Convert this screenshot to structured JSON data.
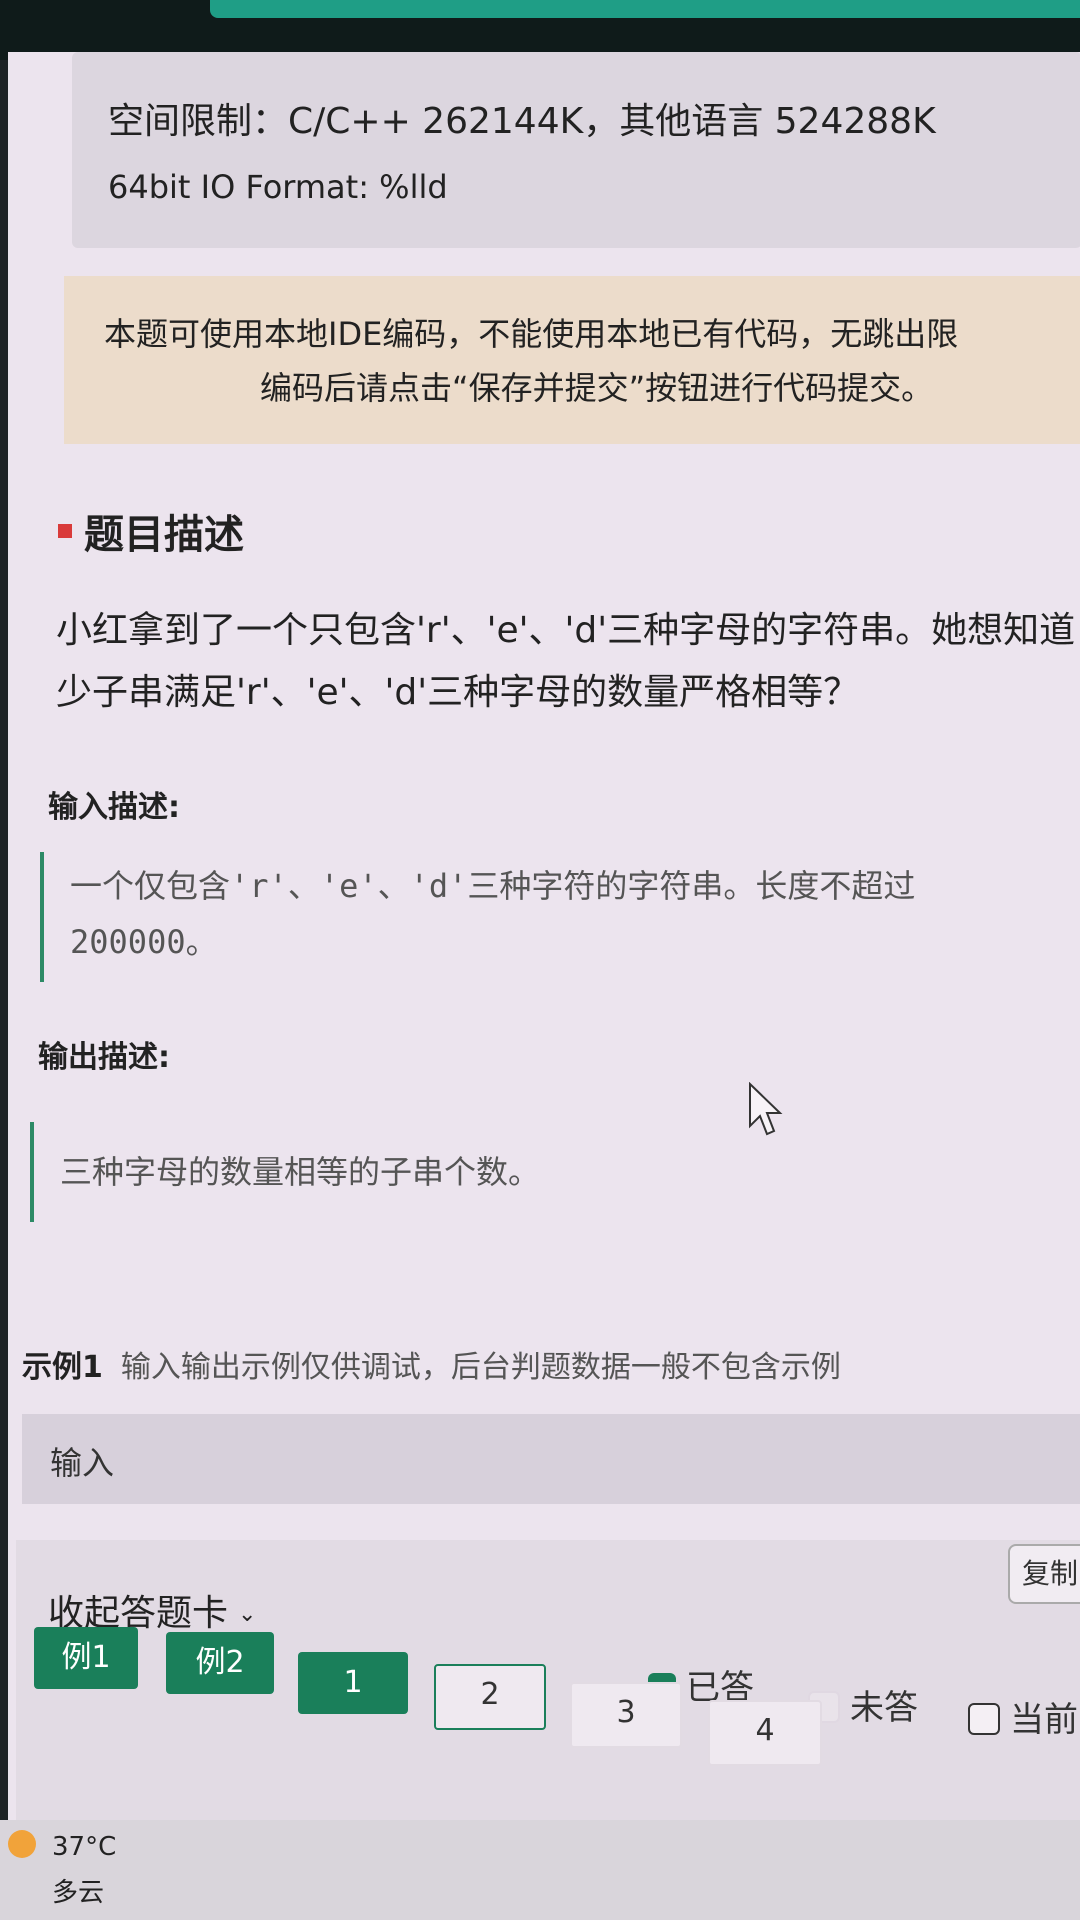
{
  "limits": {
    "space": "空间限制：C/C++ 262144K，其他语言 524288K",
    "io_format": "64bit IO Format: %lld"
  },
  "notice": {
    "line1": "本题可使用本地IDE编码，不能使用本地已有代码，无跳出限",
    "line2": "编码后请点击“保存并提交”按钮进行代码提交。"
  },
  "problem": {
    "section_title": "题目描述",
    "desc_line1": "小红拿到了一个只包含'r'、'e'、'd'三种字母的字符串。她想知道",
    "desc_line2": "少子串满足'r'、'e'、'd'三种字母的数量严格相等？",
    "input_title": "输入描述:",
    "input_line1_pre": "一个仅包含",
    "input_line1_code": "'r'、'e'、'd'",
    "input_line1_post": "三种字符的字符串。长度不超过",
    "input_line2": "200000。",
    "output_title": "输出描述:",
    "output_text": "三种字母的数量相等的子串个数。"
  },
  "example": {
    "label": "示例1",
    "hint": "输入输出示例仅供调试，后台判题数据一般不包含示例",
    "input_label": "输入",
    "copy_label": "复制"
  },
  "answer_card": {
    "collapse_label": "收起答题卡",
    "legend_done": "已答",
    "legend_todo": "未答",
    "legend_current": "当前",
    "colors": {
      "done": "#1a7f5a"
    },
    "buttons": [
      "例1",
      "例2",
      "1",
      "2",
      "3",
      "4"
    ]
  },
  "taskbar": {
    "temperature": "37°C",
    "condition": "多云",
    "weather_icon": "sun-cloud-icon"
  }
}
